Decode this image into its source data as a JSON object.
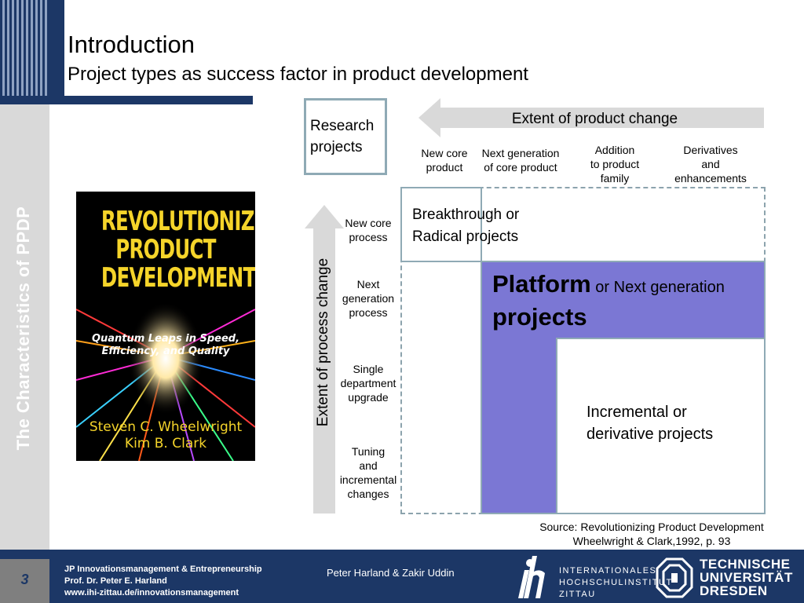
{
  "header": {
    "title": "Introduction",
    "subtitle": "Project types as success factor in product development",
    "side_label": "The Characteristics of PPDP"
  },
  "book": {
    "title_line1": "REVOLUTIONIZING",
    "title_line2": "PRODUCT",
    "title_line3": "DEVELOPMENT",
    "subtitle_line1": "Quantum Leaps in Speed,",
    "subtitle_line2": "Efficiency, and Quality",
    "author1": "Steven C. Wheelwright",
    "author2": "Kim B. Clark"
  },
  "diagram": {
    "research_line1": "Research",
    "research_line2": "projects",
    "product_axis_label": "Extent of product change",
    "process_axis_label": "Extent of process change",
    "product_categories": [
      {
        "line1": "New core",
        "line2": "product",
        "line3": ""
      },
      {
        "line1": "Next generation",
        "line2": "of core product",
        "line3": ""
      },
      {
        "line1": "Addition",
        "line2": "to product",
        "line3": "family"
      },
      {
        "line1": "Derivatives",
        "line2": "and",
        "line3": "enhancements"
      }
    ],
    "process_categories": [
      {
        "line1": "New core",
        "line2": "process",
        "line3": "",
        "line4": ""
      },
      {
        "line1": "Next",
        "line2": "generation",
        "line3": "process",
        "line4": ""
      },
      {
        "line1": "Single",
        "line2": "department",
        "line3": "upgrade",
        "line4": ""
      },
      {
        "line1": "Tuning",
        "line2": "and",
        "line3": "incremental",
        "line4": "changes"
      }
    ],
    "breakthrough_line1": "Breakthrough or",
    "breakthrough_line2": "Radical projects",
    "platform_bold": "Platform",
    "platform_rest": " or Next generation",
    "platform_line2": "projects",
    "incremental_line1": "Incremental or",
    "incremental_line2": "derivative projects",
    "platform_color": "#7b77d4",
    "source_line1": "Source: Revolutionizing Product Development",
    "source_line2": "Wheelwright & Clark,1992, p. 93"
  },
  "footer": {
    "page_number": "3",
    "line1": "JP Innovationsmanagement & Entrepreneurship",
    "line2": "Prof. Dr. Peter E. Harland",
    "line3": "www.ihi-zittau.de/innovationsmanagement",
    "presenters": "Peter Harland & Zakir Uddin",
    "ihi_line1": "INTERNATIONALES",
    "ihi_line2": "HOCHSCHULINSTITUT",
    "ihi_line3": "ZITTAU",
    "tud_line1": "TECHNISCHE",
    "tud_line2": "UNIVERSITÄT",
    "tud_line3": "DRESDEN"
  }
}
